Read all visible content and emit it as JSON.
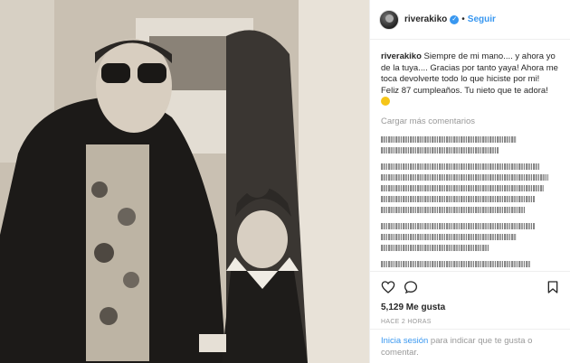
{
  "post": {
    "username": "riverakiko",
    "verified_symbol": "✓",
    "separator": "•",
    "follow_label": "Seguir",
    "caption_user": "riverakiko",
    "caption_text": "Siempre de mi mano.... y ahora yo de la tuya.... Gracias por tanto yaya! Ahora me toca devolverte todo lo que hiciste por mi! Feliz 87 cumpleaños. Tu nieto que te adora!",
    "load_more": "Cargar más comentarios",
    "likes": "5,129 Me gusta",
    "time": "HACE 2 HORAS",
    "login_link": "Inicia sesión",
    "login_text": " para indicar que te gusta o comentar."
  },
  "colors": {
    "link": "#3897f0",
    "muted": "#999999",
    "text": "#262626"
  },
  "icons": [
    "heart-icon",
    "comment-icon",
    "bookmark-icon",
    "verified-icon"
  ]
}
